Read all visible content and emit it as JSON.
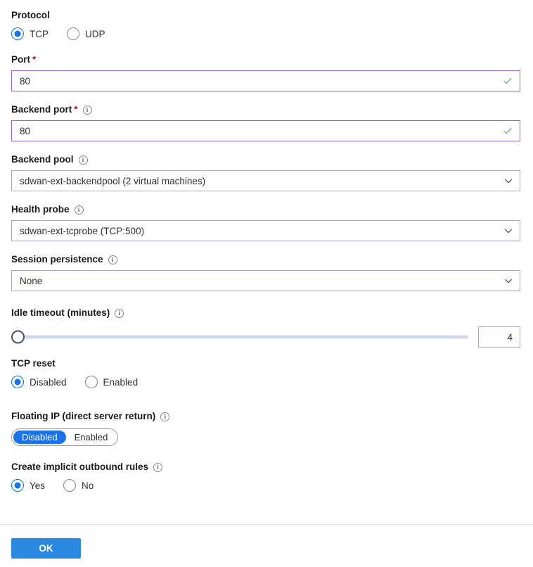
{
  "form": {
    "protocol": {
      "label": "Protocol",
      "options": [
        {
          "label": "TCP",
          "selected": true
        },
        {
          "label": "UDP",
          "selected": false
        }
      ]
    },
    "port": {
      "label": "Port",
      "required_marker": "*",
      "value": "80",
      "validation_icon": "checkmark-icon"
    },
    "backend_port": {
      "label": "Backend port",
      "required_marker": "*",
      "info_icon": "info-icon",
      "value": "80",
      "validation_icon": "checkmark-icon"
    },
    "backend_pool": {
      "label": "Backend pool",
      "info_icon": "info-icon",
      "value": "sdwan-ext-backendpool (2 virtual machines)",
      "chevron": "chevron-down-icon"
    },
    "health_probe": {
      "label": "Health probe",
      "info_icon": "info-icon",
      "value": "sdwan-ext-tcprobe (TCP:500)",
      "chevron": "chevron-down-icon"
    },
    "session_persistence": {
      "label": "Session persistence",
      "info_icon": "info-icon",
      "value": "None",
      "chevron": "chevron-down-icon"
    },
    "idle_timeout": {
      "label": "Idle timeout (minutes)",
      "info_icon": "info-icon",
      "value": "4",
      "min": 4,
      "max": 30,
      "thumb_position_percent": 0
    },
    "tcp_reset": {
      "label": "TCP reset",
      "options": [
        {
          "label": "Disabled",
          "selected": true
        },
        {
          "label": "Enabled",
          "selected": false
        }
      ]
    },
    "floating_ip": {
      "label": "Floating IP (direct server return)",
      "info_icon": "info-icon",
      "options": [
        {
          "label": "Disabled",
          "selected": true
        },
        {
          "label": "Enabled",
          "selected": false
        }
      ]
    },
    "outbound_rules": {
      "label": "Create implicit outbound rules",
      "info_icon": "info-icon",
      "options": [
        {
          "label": "Yes",
          "selected": true
        },
        {
          "label": "No",
          "selected": false
        }
      ]
    },
    "submit": {
      "label": "OK"
    }
  },
  "colors": {
    "accent_blue": "#1a73e8",
    "button_blue": "#2b88e0",
    "input_border_violet": "#8f5fd4",
    "dropdown_border": "#a3a8c9",
    "required_red": "#a4262c",
    "valid_green": "#6fbf73",
    "track_gray": "#d5d8ea"
  }
}
